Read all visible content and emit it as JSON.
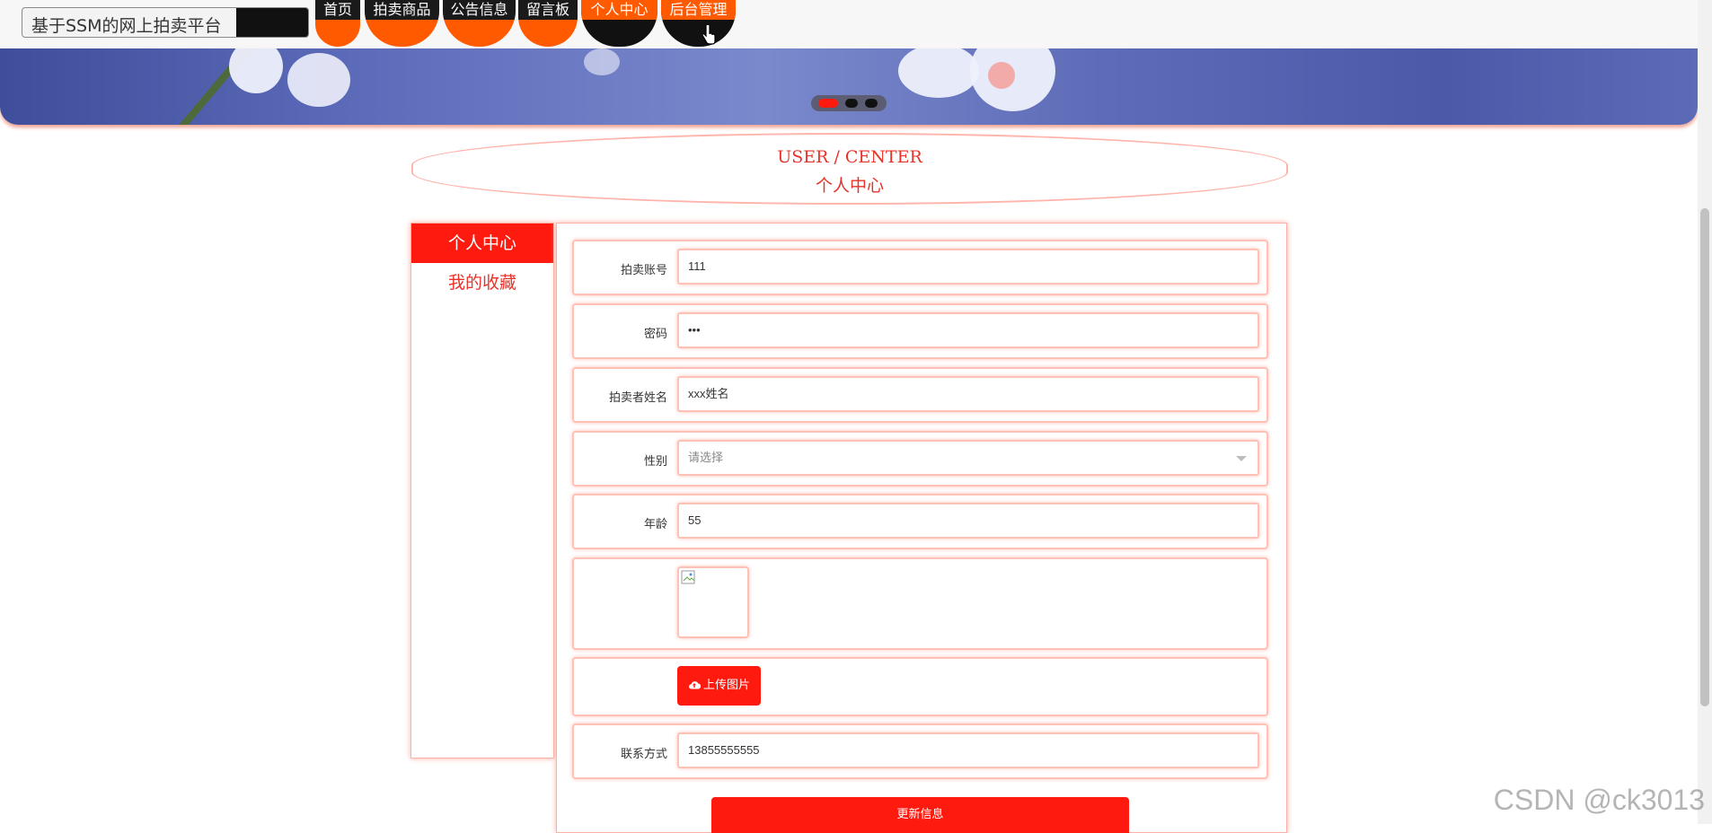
{
  "header": {
    "site_title": "基于SSM的网上拍卖平台",
    "nav": [
      {
        "label": "首页",
        "active": false
      },
      {
        "label": "拍卖商品",
        "active": false
      },
      {
        "label": "公告信息",
        "active": false
      },
      {
        "label": "留言板",
        "active": false
      },
      {
        "label": "个人中心",
        "active": true
      },
      {
        "label": "后台管理",
        "active": true
      }
    ]
  },
  "banner": {
    "slides": 3,
    "active_slide": 1
  },
  "section": {
    "title_en": "USER / CENTER",
    "title_cn": "个人中心"
  },
  "sidebar": {
    "items": [
      {
        "label": "个人中心",
        "selected": true
      },
      {
        "label": "我的收藏",
        "selected": false
      }
    ]
  },
  "form": {
    "account": {
      "label": "拍卖账号",
      "value": "111"
    },
    "password": {
      "label": "密码",
      "value": "•••"
    },
    "name": {
      "label": "拍卖者姓名",
      "value": "xxx姓名"
    },
    "gender": {
      "label": "性别",
      "placeholder": "请选择",
      "value": ""
    },
    "age": {
      "label": "年龄",
      "value": "55"
    },
    "upload_label": "上传图片",
    "contact": {
      "label": "联系方式",
      "value": "13855555555"
    },
    "submit_label": "更新信息"
  },
  "colors": {
    "primary": "#ff1a10",
    "accent_orange": "#ff5a00",
    "border_pink": "#ffb0a5",
    "heading_red": "#e8332a"
  },
  "watermark": "CSDN @ck3013"
}
